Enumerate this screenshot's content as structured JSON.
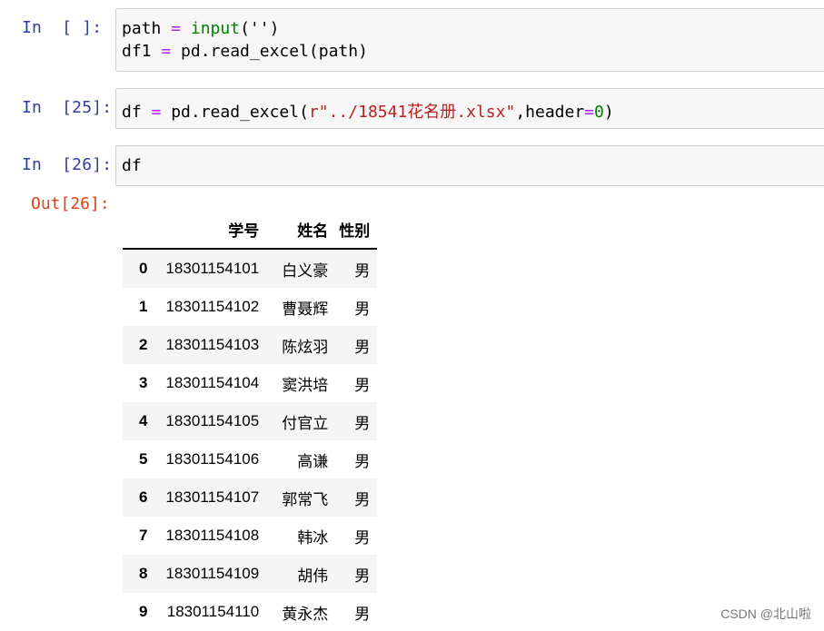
{
  "cells": [
    {
      "prompt": "In  [ ]:",
      "lines": [
        {
          "a": "path",
          "op": " = ",
          "fn": "input",
          "rest": "('')"
        },
        {
          "a": "df1",
          "op": " = ",
          "fn": "",
          "rest": "pd.read_excel(path)"
        }
      ]
    },
    {
      "prompt": "In  [25]:",
      "line": {
        "a": "df",
        "op": " = ",
        "call": "pd.read_excel(",
        "str": "r\"../18541花名册.xlsx\"",
        "mid": ",header",
        "eq": "=",
        "num": "0",
        "end": ")"
      }
    },
    {
      "prompt": "In  [26]:",
      "line": "df"
    }
  ],
  "output": {
    "prompt": "Out[26]:",
    "columns": [
      "学号",
      "姓名",
      "性别"
    ],
    "rows": [
      {
        "index": "0",
        "id": "18301154101",
        "name": "白义豪",
        "sex": "男"
      },
      {
        "index": "1",
        "id": "18301154102",
        "name": "曹聂辉",
        "sex": "男"
      },
      {
        "index": "2",
        "id": "18301154103",
        "name": "陈炫羽",
        "sex": "男"
      },
      {
        "index": "3",
        "id": "18301154104",
        "name": "窦洪培",
        "sex": "男"
      },
      {
        "index": "4",
        "id": "18301154105",
        "name": "付官立",
        "sex": "男"
      },
      {
        "index": "5",
        "id": "18301154106",
        "name": "高谦",
        "sex": "男"
      },
      {
        "index": "6",
        "id": "18301154107",
        "name": "郭常飞",
        "sex": "男"
      },
      {
        "index": "7",
        "id": "18301154108",
        "name": "韩冰",
        "sex": "男"
      },
      {
        "index": "8",
        "id": "18301154109",
        "name": "胡伟",
        "sex": "男"
      },
      {
        "index": "9",
        "id": "18301154110",
        "name": "黄永杰",
        "sex": "男"
      }
    ]
  },
  "watermark": "CSDN @北山啦",
  "colors": {
    "prompt_in": "#303F9F",
    "prompt_out": "#D84315",
    "keyword_green": "#008000",
    "operator": "#AA22FF",
    "string": "#BA2121",
    "cell_bg": "#f7f7f7"
  }
}
